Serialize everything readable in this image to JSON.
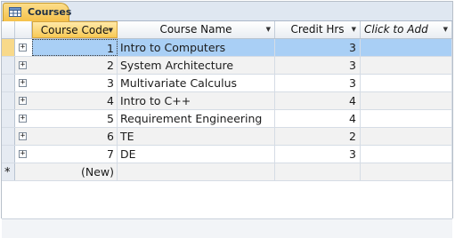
{
  "tab": {
    "label": "Courses",
    "icon": "table-icon"
  },
  "columns": [
    {
      "label": "Course Code",
      "key": "code"
    },
    {
      "label": "Course Name",
      "key": "name"
    },
    {
      "label": "Credit Hrs",
      "key": "credit"
    },
    {
      "label": "Click to Add",
      "key": "add"
    }
  ],
  "rows": [
    {
      "code": "1",
      "name": "Intro to Computers",
      "credit": "3"
    },
    {
      "code": "2",
      "name": "System Architecture",
      "credit": "3"
    },
    {
      "code": "3",
      "name": "Multivariate Calculus",
      "credit": "3"
    },
    {
      "code": "4",
      "name": "Intro to C++",
      "credit": "4"
    },
    {
      "code": "5",
      "name": "Requirement Engineering",
      "credit": "4"
    },
    {
      "code": "6",
      "name": "TE",
      "credit": "2"
    },
    {
      "code": "7",
      "name": "DE",
      "credit": "3"
    }
  ],
  "new_row": {
    "marker": "*",
    "label": "(New)"
  },
  "expand_symbol": "+",
  "colors": {
    "tab": "#f5c14a",
    "selected_row": "#a9cff5",
    "header_selected": "#f8c955"
  }
}
